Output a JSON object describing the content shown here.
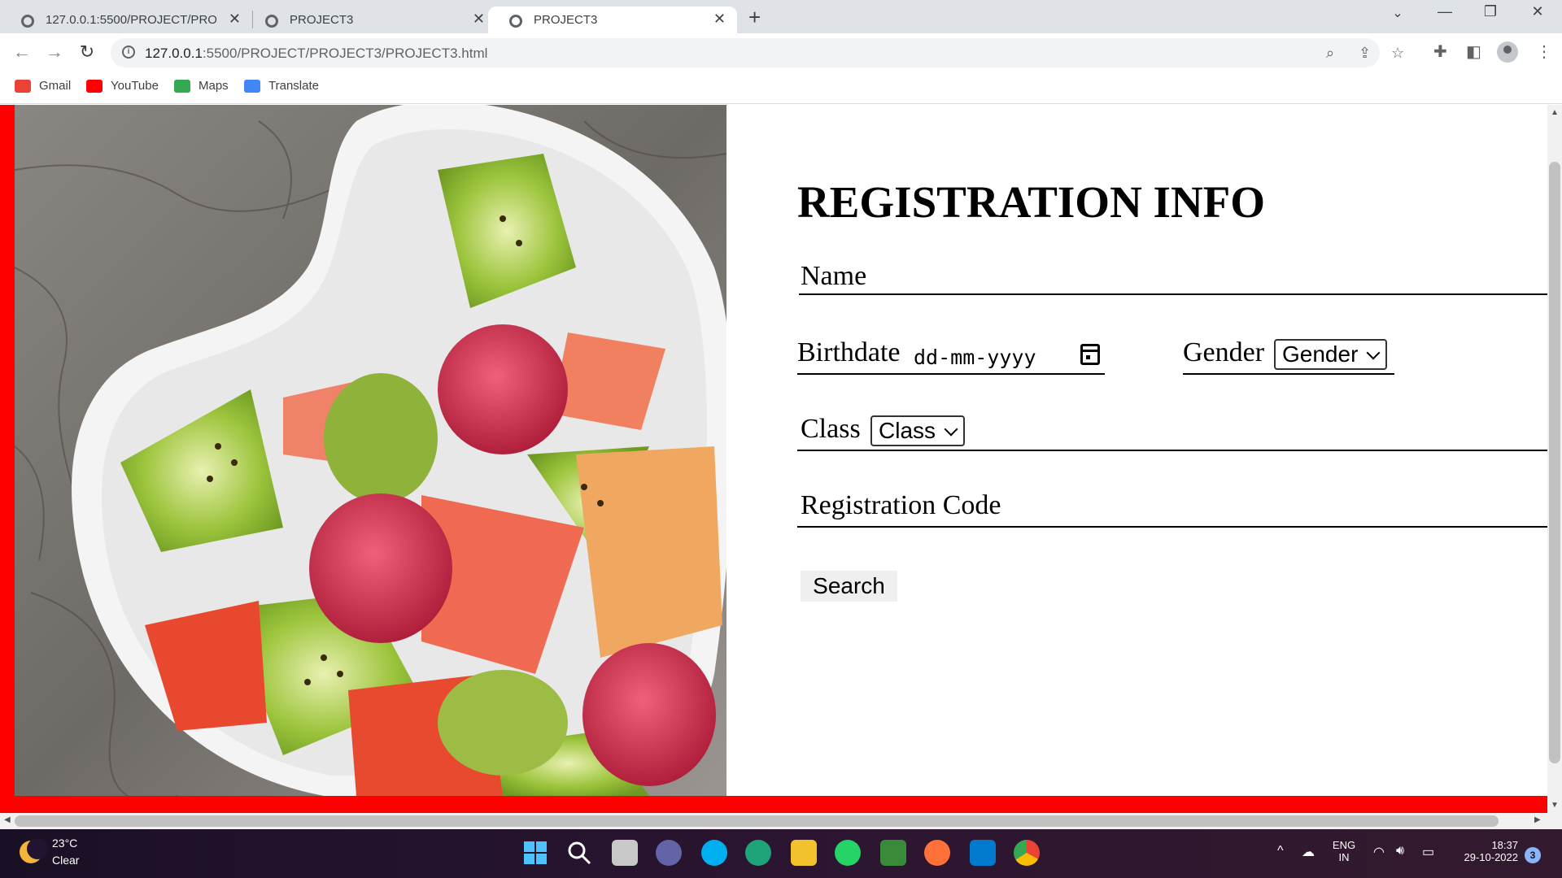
{
  "browser": {
    "tabs": [
      {
        "label": "127.0.0.1:5500/PROJECT/PROJEC"
      },
      {
        "label": "PROJECT3"
      },
      {
        "label": "PROJECT3"
      }
    ],
    "url_host": "127.0.0.1",
    "url_rest": ":5500/PROJECT/PROJECT3/PROJECT3.html",
    "bookmarks": [
      {
        "label": "Gmail",
        "color": "#ea4335"
      },
      {
        "label": "YouTube",
        "color": "#ff0000"
      },
      {
        "label": "Maps",
        "color": "#34a853"
      },
      {
        "label": "Translate",
        "color": "#4285f4"
      }
    ]
  },
  "page": {
    "title": "REGISTRATION INFO",
    "name_label": "Name",
    "birthdate_label": "Birthdate",
    "date_placeholder": "dd-mm-yyyy",
    "gender_label": "Gender",
    "gender_selected": "Gender",
    "class_label": "Class",
    "class_selected": "Class",
    "regcode_label": "Registration Code",
    "search_button": "Search",
    "accent_color": "#ff0000"
  },
  "taskbar": {
    "temperature": "23°C",
    "condition": "Clear",
    "lang_line1": "ENG",
    "lang_line2": "IN",
    "time": "18:37",
    "date": "29-10-2022",
    "notification_count": "3"
  }
}
